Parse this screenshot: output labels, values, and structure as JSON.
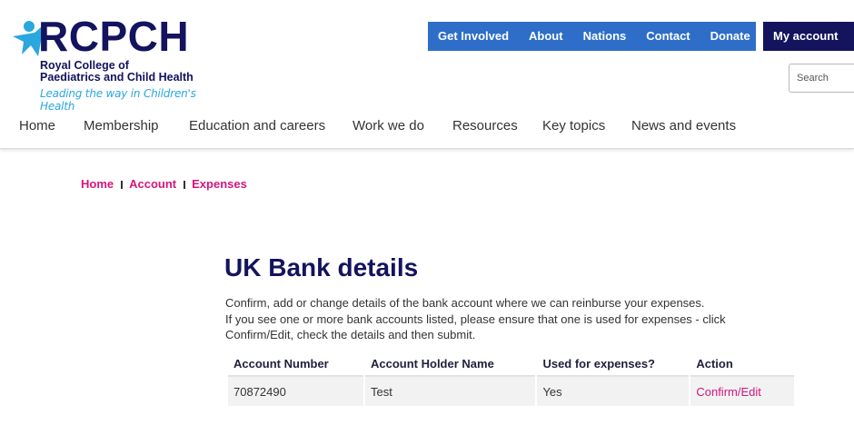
{
  "brand": {
    "name": "RCPCH",
    "subtitle_line1": "Royal College of",
    "subtitle_line2": "Paediatrics and Child Health",
    "tagline": "Leading the way in Children's Health",
    "colors": {
      "navy": "#13135e",
      "blue": "#2e6ec9",
      "pink": "#d5157e",
      "sky": "#2aa7df"
    }
  },
  "top_links": [
    "Get Involved",
    "About",
    "Nations",
    "Contact",
    "Donate"
  ],
  "my_account": "My account",
  "search": {
    "placeholder": "Search"
  },
  "nav": [
    "Home",
    "Membership",
    "Education and careers",
    "Work we do",
    "Resources",
    "Key topics",
    "News and events"
  ],
  "breadcrumb": [
    "Home",
    "Account",
    "Expenses"
  ],
  "page": {
    "title": "UK Bank details",
    "intro_line1": "Confirm, add or change details of the bank account where we can reinburse your expenses.",
    "intro_line2": "If you see one or more bank accounts listed, please ensure that one is used for expenses - click",
    "intro_line3": "Confirm/Edit, check the details and then submit."
  },
  "table": {
    "headers": [
      "Account Number",
      "Account Holder Name",
      "Used for expenses?",
      "Action"
    ],
    "rows": [
      {
        "account_number": "70872490",
        "holder": "Test",
        "used": "Yes",
        "action": "Confirm/Edit"
      }
    ]
  }
}
